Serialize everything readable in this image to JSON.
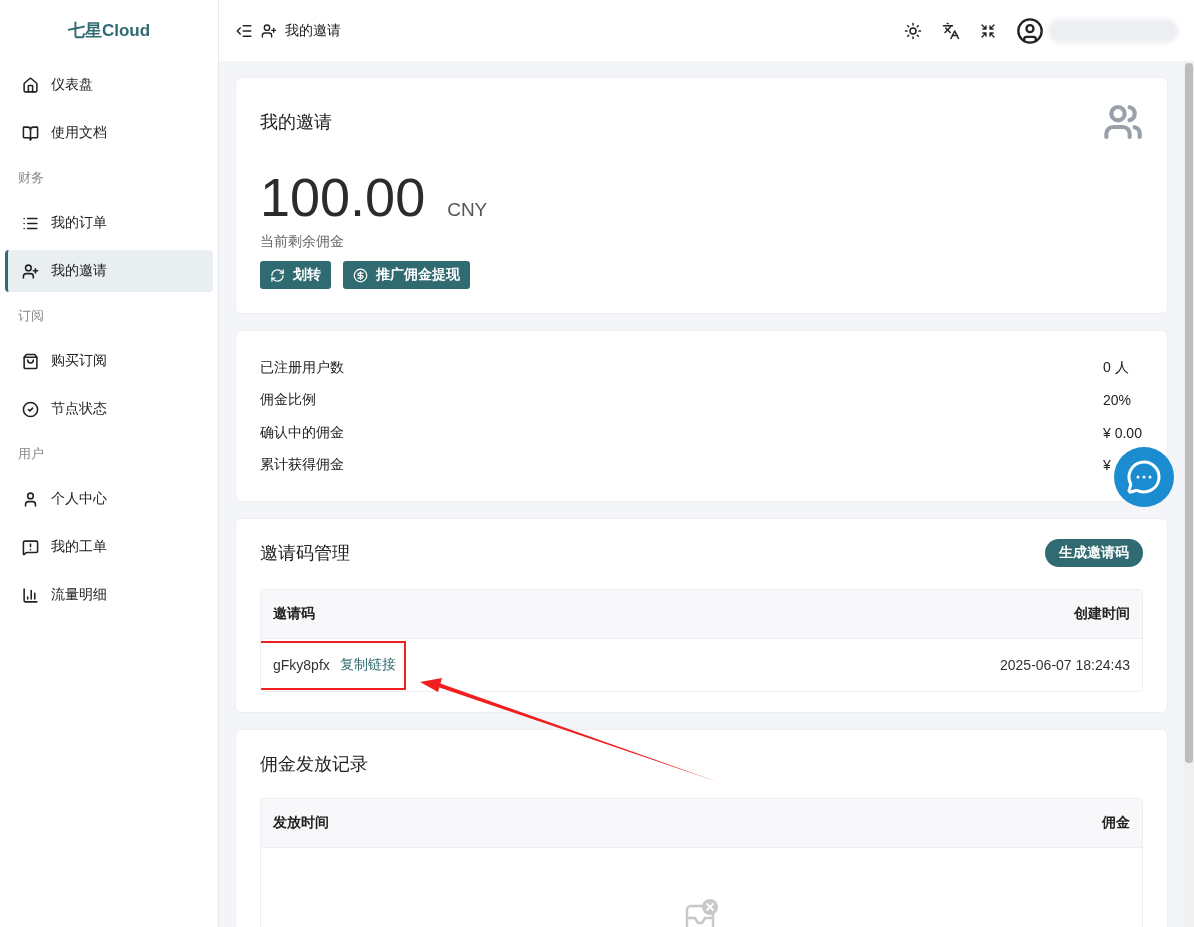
{
  "brand": "七星Cloud",
  "sidebar": {
    "items": [
      {
        "kind": "item",
        "label": "仪表盘",
        "selected": false
      },
      {
        "kind": "item",
        "label": "使用文档",
        "selected": false
      },
      {
        "kind": "section",
        "label": "财务"
      },
      {
        "kind": "item",
        "label": "我的订单",
        "selected": false
      },
      {
        "kind": "item",
        "label": "我的邀请",
        "selected": true
      },
      {
        "kind": "section",
        "label": "订阅"
      },
      {
        "kind": "item",
        "label": "购买订阅",
        "selected": false
      },
      {
        "kind": "item",
        "label": "节点状态",
        "selected": false
      },
      {
        "kind": "section",
        "label": "用户"
      },
      {
        "kind": "item",
        "label": "个人中心",
        "selected": false
      },
      {
        "kind": "item",
        "label": "我的工单",
        "selected": false
      },
      {
        "kind": "item",
        "label": "流量明细",
        "selected": false
      }
    ]
  },
  "header": {
    "breadcrumb": "我的邀请"
  },
  "balance_card": {
    "title": "我的邀请",
    "amount": "100.00",
    "currency": "CNY",
    "caption": "当前剩余佣金",
    "buttons": [
      "划转",
      "推广佣金提现"
    ]
  },
  "stats": [
    {
      "label": "已注册用户数",
      "value": "0 人"
    },
    {
      "label": "佣金比例",
      "value": "20%"
    },
    {
      "label": "确认中的佣金",
      "value": "¥ 0.00"
    },
    {
      "label": "累计获得佣金",
      "value": "¥"
    }
  ],
  "codes_card": {
    "title": "邀请码管理",
    "button": "生成邀请码",
    "columns": [
      "邀请码",
      "创建时间"
    ],
    "rows": [
      {
        "code": "gFky8pfx",
        "link": "复制链接",
        "created": "2025-06-07 18:24:43"
      }
    ]
  },
  "records_card": {
    "title": "佣金发放记录",
    "columns": [
      "发放时间",
      "佣金"
    ]
  }
}
